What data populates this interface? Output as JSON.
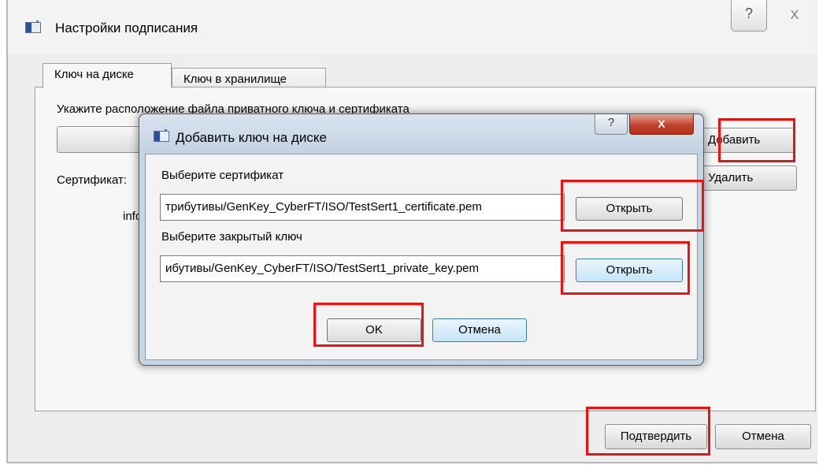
{
  "main_window": {
    "title": "Настройки подписания",
    "help_glyph": "?",
    "close_glyph": "X",
    "tabs": [
      {
        "label": "Ключ на диске",
        "active": true
      },
      {
        "label": "Ключ в хранилище",
        "active": false
      }
    ],
    "instruction": "Укажите расположение файла приватного ключа и сертификата",
    "certificate_label": "Сертификат:",
    "info_text": "info",
    "add_button": "Добавить",
    "delete_button": "Удалить",
    "confirm_button": "Подтвердить",
    "cancel_button": "Отмена"
  },
  "dialog": {
    "title": "Добавить ключ на диске",
    "help_glyph": "?",
    "close_glyph": "X",
    "certificate_label": "Выберите сертификат",
    "certificate_path": "трибутивы/GenKey_CyberFT/ISO/TestSert1_certificate.pem",
    "key_label": "Выберите закрытый ключ",
    "key_path": "ибутивы/GenKey_CyberFT/ISO/TestSert1_private_key.pem",
    "open_button_1": "Открыть",
    "open_button_2": "Открыть",
    "ok_button": "OK",
    "cancel_button": "Отмена"
  },
  "colors": {
    "highlight": "#ee1111",
    "dialog_frame": "#c6d3e1",
    "close_button": "#c0432c"
  },
  "icons": [
    "app-window-icon",
    "help-icon",
    "close-icon"
  ]
}
